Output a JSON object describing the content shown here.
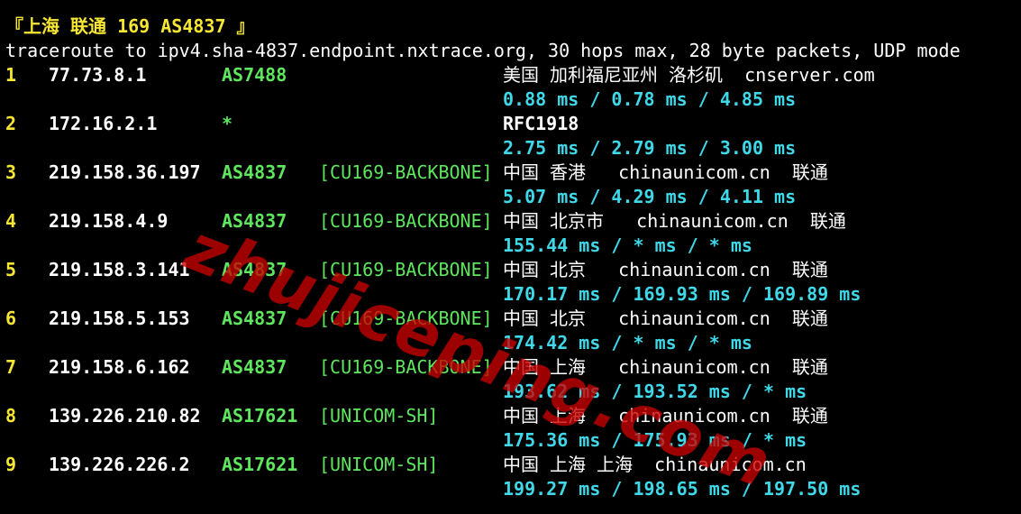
{
  "header": "『上海 联通 169 AS4837 』",
  "command": "traceroute to ipv4.sha-4837.endpoint.nxtrace.org, 30 hops max, 28 byte packets, UDP mode",
  "watermark": "zhujiceping.com",
  "colors": {
    "background": "#000000",
    "hop_number": "#f5e633",
    "asn": "#5ee65e",
    "rtt": "#3fd8e8",
    "watermark": "#c80000"
  },
  "hops": [
    {
      "num": "1",
      "ip": "77.73.8.1",
      "asn": "AS7488",
      "tag": "",
      "geo": "美国 加利福尼亚州 洛杉矶  cnserver.com",
      "geo_bold": false,
      "rtt": "0.88 ms / 0.78 ms / 4.85 ms"
    },
    {
      "num": "2",
      "ip": "172.16.2.1",
      "asn": "*",
      "tag": "",
      "geo": "RFC1918",
      "geo_bold": true,
      "rtt": "2.75 ms / 2.79 ms / 3.00 ms"
    },
    {
      "num": "3",
      "ip": "219.158.36.197",
      "asn": "AS4837",
      "tag": "[CU169-BACKBONE]",
      "geo": "中国 香港   chinaunicom.cn  联通",
      "geo_bold": false,
      "rtt": "5.07 ms / 4.29 ms / 4.11 ms"
    },
    {
      "num": "4",
      "ip": "219.158.4.9",
      "asn": "AS4837",
      "tag": "[CU169-BACKBONE]",
      "geo": "中国 北京市   chinaunicom.cn  联通",
      "geo_bold": false,
      "rtt": "155.44 ms / * ms / * ms"
    },
    {
      "num": "5",
      "ip": "219.158.3.141",
      "asn": "AS4837",
      "tag": "[CU169-BACKBONE]",
      "geo": "中国 北京   chinaunicom.cn  联通",
      "geo_bold": false,
      "rtt": "170.17 ms / 169.93 ms / 169.89 ms"
    },
    {
      "num": "6",
      "ip": "219.158.5.153",
      "asn": "AS4837",
      "tag": "[CU169-BACKBONE]",
      "geo": "中国 北京   chinaunicom.cn  联通",
      "geo_bold": false,
      "rtt": "174.42 ms / * ms / * ms"
    },
    {
      "num": "7",
      "ip": "219.158.6.162",
      "asn": "AS4837",
      "tag": "[CU169-BACKBONE]",
      "geo": "中国 上海   chinaunicom.cn  联通",
      "geo_bold": false,
      "rtt": "193.62 ms / 193.52 ms / * ms"
    },
    {
      "num": "8",
      "ip": "139.226.210.82",
      "asn": "AS17621",
      "tag": "[UNICOM-SH]",
      "geo": "中国 上海   chinaunicom.cn  联通",
      "geo_bold": false,
      "rtt": "175.36 ms / 175.93 ms / * ms"
    },
    {
      "num": "9",
      "ip": "139.226.226.2",
      "asn": "AS17621",
      "tag": "[UNICOM-SH]",
      "geo": "中国 上海 上海  chinaunicom.cn",
      "geo_bold": false,
      "rtt": "199.27 ms / 198.65 ms / 197.50 ms"
    }
  ]
}
